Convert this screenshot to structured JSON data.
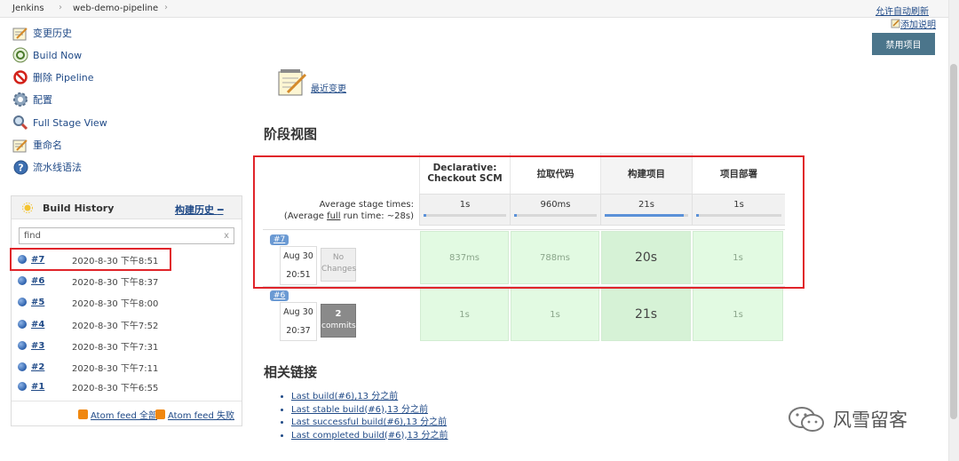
{
  "breadcrumb": {
    "items": [
      "Jenkins",
      "web-demo-pipeline"
    ],
    "separator": "›"
  },
  "top_links": {
    "auto_refresh": "允许自动刷新",
    "add_description": "添加说明"
  },
  "side_menu": {
    "items": [
      {
        "label": "变更历史",
        "icon": "notepad-icon"
      },
      {
        "label": "Build Now",
        "icon": "build-now-icon"
      },
      {
        "label": "删除 Pipeline",
        "icon": "no-entry-icon"
      },
      {
        "label": "配置",
        "icon": "gear-icon"
      },
      {
        "label": "Full Stage View",
        "icon": "magnifier-icon"
      },
      {
        "label": "重命名",
        "icon": "notepad-icon"
      },
      {
        "label": "流水线语法",
        "icon": "help-icon"
      }
    ]
  },
  "build_history": {
    "title": "Build History",
    "trend_label": "构建历史",
    "trend_suffix": "━",
    "search_value": "find",
    "search_clear": "x",
    "builds": [
      {
        "number": "#7",
        "date": "2020-8-30 下午8:51"
      },
      {
        "number": "#6",
        "date": "2020-8-30 下午8:37"
      },
      {
        "number": "#5",
        "date": "2020-8-30 下午8:00"
      },
      {
        "number": "#4",
        "date": "2020-8-30 下午7:52"
      },
      {
        "number": "#3",
        "date": "2020-8-30 下午7:31"
      },
      {
        "number": "#2",
        "date": "2020-8-30 下午7:11"
      },
      {
        "number": "#1",
        "date": "2020-8-30 下午6:55"
      }
    ],
    "feeds": {
      "all": "Atom feed 全部",
      "failed": "Atom feed 失败"
    }
  },
  "actions": {
    "disable_project": "禁用项目"
  },
  "recent_changes": {
    "label": "最近变更"
  },
  "stage_view": {
    "heading": "阶段视图",
    "avg_label_line1": "Average stage times:",
    "avg_label_line2_prefix": "(Average ",
    "avg_label_line2_link": "full",
    "avg_label_line2_suffix": " run time: ~28s)",
    "stages": [
      {
        "name": "Declarative: Checkout SCM",
        "avg": "1s",
        "avg_fraction": 0.03
      },
      {
        "name": "拉取代码",
        "avg": "960ms",
        "avg_fraction": 0.03
      },
      {
        "name": "构建项目",
        "avg": "21s",
        "avg_fraction": 0.95
      },
      {
        "name": "项目部署",
        "avg": "1s",
        "avg_fraction": 0.03
      }
    ],
    "runs": [
      {
        "badge": "#7",
        "date": "Aug 30",
        "time": "20:51",
        "changes": "No Changes",
        "durations": [
          "837ms",
          "788ms",
          "20s",
          "1s"
        ]
      },
      {
        "badge": "#6",
        "date": "Aug 30",
        "time": "20:37",
        "changes_count": "2",
        "changes_word": "commits",
        "durations": [
          "1s",
          "1s",
          "21s",
          "1s"
        ]
      }
    ]
  },
  "related_links": {
    "heading": "相关链接",
    "items": [
      "Last build(#6),13 分之前",
      "Last stable build(#6),13 分之前",
      "Last successful build(#6),13 分之前",
      "Last completed build(#6),13 分之前"
    ]
  },
  "watermark": {
    "text": "风雪留客"
  },
  "colors": {
    "highlight_red": "#e0242a",
    "accent_blue": "#4b758b",
    "success_green": "#e2fae2"
  }
}
